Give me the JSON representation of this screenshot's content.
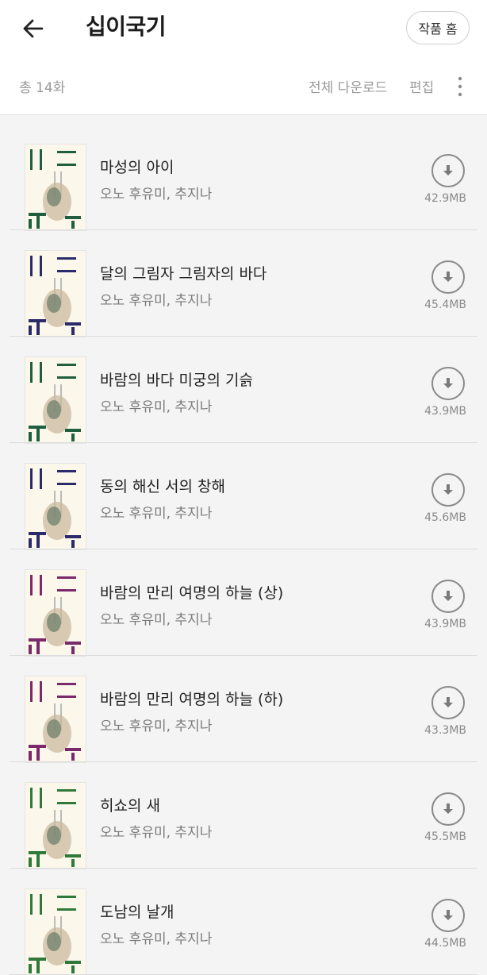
{
  "header": {
    "title": "십이국기",
    "home_button": "작품 홈",
    "episode_count": "총 14화",
    "download_all": "전체 다운로드",
    "edit": "편집",
    "back_icon": "arrow-left-icon",
    "more_icon": "more-vertical-icon"
  },
  "episodes": [
    {
      "title": "마성의 아이",
      "author": "오노 후유미, 추지나",
      "size": "42.9MB",
      "accent": "#1f5f3f"
    },
    {
      "title": "달의 그림자 그림자의 바다",
      "author": "오노 후유미, 추지나",
      "size": "45.4MB",
      "accent": "#2b2b6b"
    },
    {
      "title": "바람의 바다 미궁의 기슭",
      "author": "오노 후유미, 추지나",
      "size": "43.9MB",
      "accent": "#1f5f3f"
    },
    {
      "title": "동의 해신 서의 창해",
      "author": "오노 후유미, 추지나",
      "size": "45.6MB",
      "accent": "#2b2b6b"
    },
    {
      "title": "바람의 만리 여명의 하늘 (상)",
      "author": "오노 후유미, 추지나",
      "size": "43.9MB",
      "accent": "#7a2a6a"
    },
    {
      "title": "바람의 만리 여명의 하늘 (하)",
      "author": "오노 후유미, 추지나",
      "size": "43.3MB",
      "accent": "#7a2a6a"
    },
    {
      "title": "히쇼의 새",
      "author": "오노 후유미, 추지나",
      "size": "45.5MB",
      "accent": "#2f7a3a"
    },
    {
      "title": "도남의 날개",
      "author": "오노 후유미, 추지나",
      "size": "44.5MB",
      "accent": "#2f7a3a"
    }
  ]
}
